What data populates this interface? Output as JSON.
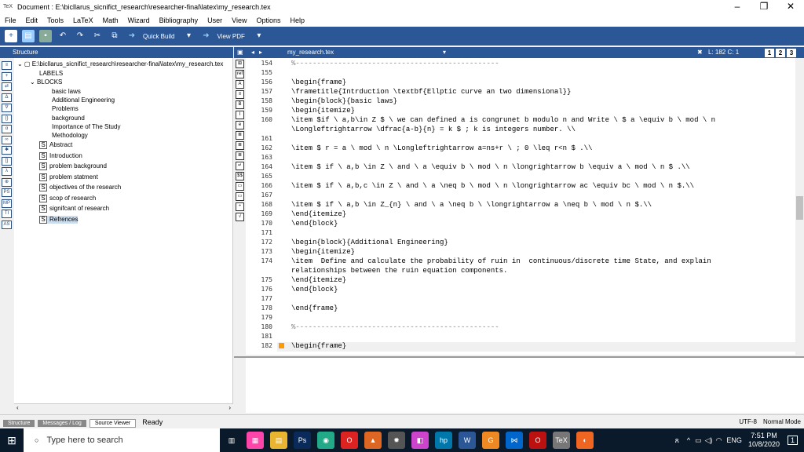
{
  "window": {
    "title": "Document : E:\\bicllarus_sicnifict_research\\researcher-final\\latex\\my_research.tex",
    "app_icon": "TeX"
  },
  "menu": [
    "File",
    "Edit",
    "Tools",
    "LaTeX",
    "Math",
    "Wizard",
    "Bibliography",
    "User",
    "View",
    "Options",
    "Help"
  ],
  "toolbar": {
    "quick_build": "Quick Build",
    "view_pdf": "View PDF"
  },
  "structure": {
    "header": "Structure",
    "root": "E:\\bicllarus_sicnifict_research\\researcher-final\\latex\\my_research.tex",
    "labels": "LABELS",
    "blocks": "BLOCKS",
    "block_items": [
      "basic laws",
      "Additional Engineering",
      "Problems",
      "background",
      "Importance of The Study",
      "Methodology"
    ],
    "sections": [
      "Abstract",
      "Introduction",
      "problem background",
      "problem statment",
      "objectives of the research",
      "scop of research",
      "signifcant of research",
      "Refrences"
    ]
  },
  "editor": {
    "tab": "my_research.tex",
    "position": "L: 182 C: 1",
    "panes": [
      "1",
      "2",
      "3"
    ],
    "lines": [
      {
        "n": "154",
        "t": "%------------------------------------------------",
        "c": true
      },
      {
        "n": "155",
        "t": ""
      },
      {
        "n": "156",
        "t": "\\begin{frame}"
      },
      {
        "n": "157",
        "t": "\\frametitle{Intrduction \\textbf{Ellptic curve an two dimensional}}"
      },
      {
        "n": "158",
        "t": "\\begin{block}{basic laws}"
      },
      {
        "n": "159",
        "t": "\\begin{itemize}"
      },
      {
        "n": "160",
        "t": "\\item $if \\ a,b\\in Z $ \\ we can defined a is congrunet b modulo n and Write \\ $ a \\equiv b \\ mod \\ n"
      },
      {
        "n": "",
        "t": "\\Longleftrightarrow \\dfrac{a-b}{n} = k $ ; k is integers number. \\\\"
      },
      {
        "n": "161",
        "t": ""
      },
      {
        "n": "162",
        "t": "\\item $ r = a \\ mod \\ n \\Longleftrightarrow a=ns+r \\ ; 0 \\leq r<n $ .\\\\"
      },
      {
        "n": "163",
        "t": ""
      },
      {
        "n": "164",
        "t": "\\item $ if \\ a,b \\in Z \\ and \\ a \\equiv b \\ mod \\ n \\longrightarrow b \\equiv a \\ mod \\ n $ .\\\\"
      },
      {
        "n": "165",
        "t": ""
      },
      {
        "n": "166",
        "t": "\\item $ if \\ a,b,c \\in Z \\ and \\ a \\neq b \\ mod \\ n \\longrightarrow ac \\equiv bc \\ mod \\ n $.\\\\"
      },
      {
        "n": "167",
        "t": ""
      },
      {
        "n": "168",
        "t": "\\item $ if \\ a,b \\in Z_{n} \\ and \\ a \\neq b \\ \\longrightarrow a \\neq b \\ mod \\ n $.\\\\"
      },
      {
        "n": "169",
        "t": "\\end{itemize}"
      },
      {
        "n": "170",
        "t": "\\end{block}"
      },
      {
        "n": "171",
        "t": ""
      },
      {
        "n": "172",
        "t": "\\begin{block}{Additional Engineering}"
      },
      {
        "n": "173",
        "t": "\\begin{itemize}"
      },
      {
        "n": "174",
        "t": "\\item  Define and calculate the probability of ruin in  continuous/discrete time State, and explain"
      },
      {
        "n": "",
        "t": "relationships between the ruin equation components."
      },
      {
        "n": "175",
        "t": "\\end{itemize}"
      },
      {
        "n": "176",
        "t": "\\end{block}"
      },
      {
        "n": "177",
        "t": ""
      },
      {
        "n": "178",
        "t": "\\end{frame}"
      },
      {
        "n": "179",
        "t": ""
      },
      {
        "n": "180",
        "t": "%------------------------------------------------",
        "c": true
      },
      {
        "n": "181",
        "t": ""
      },
      {
        "n": "182",
        "t": "\\begin{frame}"
      }
    ]
  },
  "status": {
    "tabs": [
      "Structure",
      "Messages / Log",
      "Source Viewer"
    ],
    "ready": "Ready",
    "encoding": "UTF-8",
    "mode": "Normal Mode"
  },
  "taskbar": {
    "search": "Type here to search",
    "time": "7:51 PM",
    "date": "10/8/2020",
    "lang": "ENG",
    "notif": "1"
  }
}
